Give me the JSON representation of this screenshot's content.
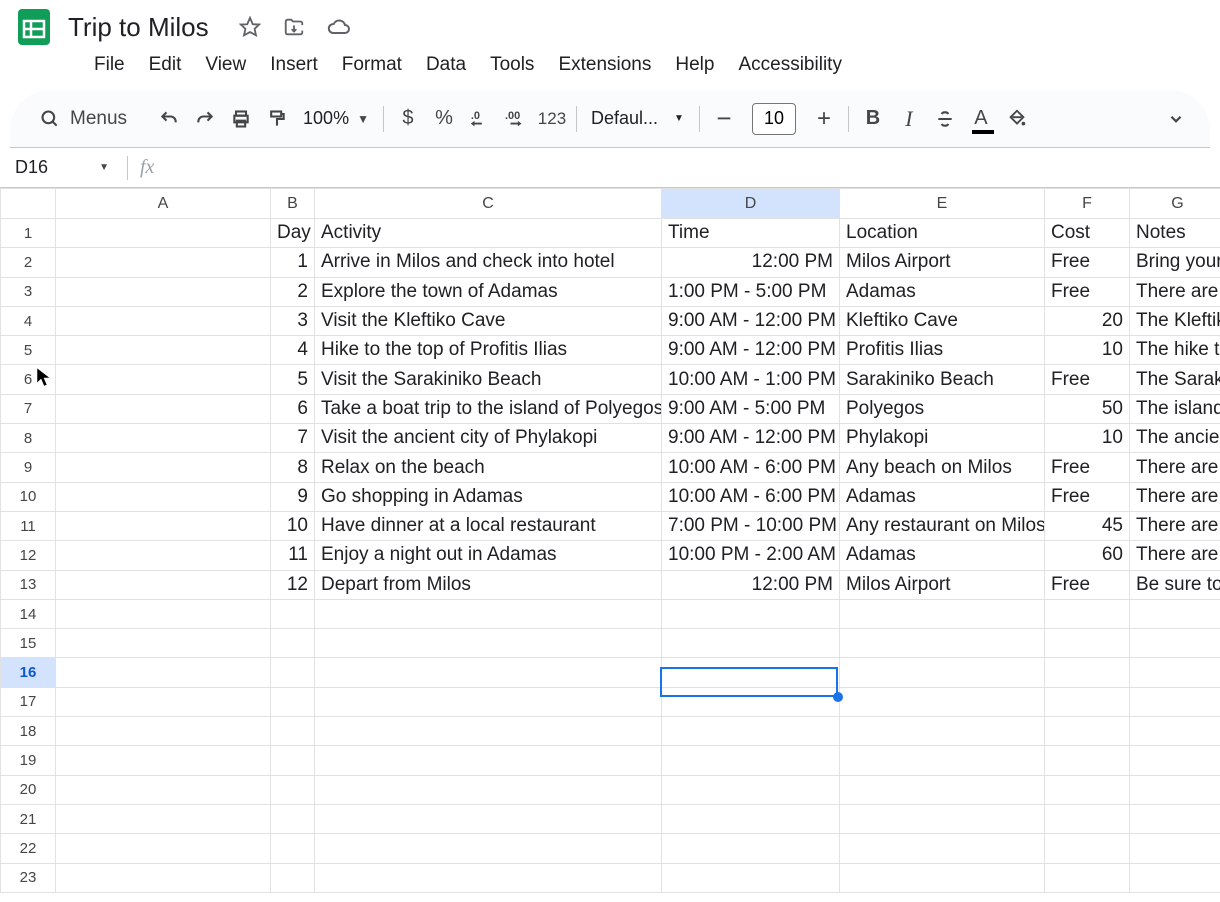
{
  "doc": {
    "title": "Trip to Milos"
  },
  "menubar": {
    "file": "File",
    "edit": "Edit",
    "view": "View",
    "insert": "Insert",
    "format": "Format",
    "data": "Data",
    "tools": "Tools",
    "extensions": "Extensions",
    "help": "Help",
    "accessibility": "Accessibility"
  },
  "toolbar": {
    "menus_label": "Menus",
    "zoom": "100%",
    "numfmt_123": "123",
    "font_name": "Defaul...",
    "font_size": "10"
  },
  "namebox": {
    "cell_ref": "D16",
    "formula": ""
  },
  "columns": [
    "A",
    "B",
    "C",
    "D",
    "E",
    "F",
    "G"
  ],
  "active_col": "D",
  "active_row": 16,
  "selected_cell": "D16",
  "row_count": 23,
  "headers": {
    "B": "Day",
    "C": "Activity",
    "D": "Time",
    "E": "Location",
    "F": "Cost",
    "G": "Notes"
  },
  "rows": [
    {
      "day": "1",
      "activity": "Arrive in Milos and check into hotel",
      "time": "12:00 PM",
      "location": "Milos Airport",
      "cost": "Free",
      "notes": "Bring your"
    },
    {
      "day": "2",
      "activity": "Explore the town of Adamas",
      "time": "1:00 PM - 5:00 PM",
      "location": "Adamas",
      "cost": "Free",
      "notes": "There are"
    },
    {
      "day": "3",
      "activity": "Visit the Kleftiko Cave",
      "time": "9:00 AM - 12:00 PM",
      "location": "Kleftiko Cave",
      "cost": "20",
      "notes": "The Kleftik"
    },
    {
      "day": "4",
      "activity": "Hike to the top of Profitis Ilias",
      "time": "9:00 AM - 12:00 PM",
      "location": "Profitis Ilias",
      "cost": "10",
      "notes": "The hike to"
    },
    {
      "day": "5",
      "activity": "Visit the Sarakiniko Beach",
      "time": "10:00 AM - 1:00 PM",
      "location": "Sarakiniko Beach",
      "cost": "Free",
      "notes": "The Sarak"
    },
    {
      "day": "6",
      "activity": "Take a boat trip to the island of Polyegos",
      "time": "9:00 AM - 5:00 PM",
      "location": "Polyegos",
      "cost": "50",
      "notes": "The island"
    },
    {
      "day": "7",
      "activity": "Visit the ancient city of Phylakopi",
      "time": "9:00 AM - 12:00 PM",
      "location": "Phylakopi",
      "cost": "10",
      "notes": "The ancien"
    },
    {
      "day": "8",
      "activity": "Relax on the beach",
      "time": "10:00 AM - 6:00 PM",
      "location": "Any beach on Milos",
      "cost": "Free",
      "notes": "There are"
    },
    {
      "day": "9",
      "activity": "Go shopping in Adamas",
      "time": "10:00 AM - 6:00 PM",
      "location": "Adamas",
      "cost": "Free",
      "notes": "There are"
    },
    {
      "day": "10",
      "activity": "Have dinner at a local restaurant",
      "time": "7:00 PM - 10:00 PM",
      "location": "Any restaurant on Milos",
      "cost": "45",
      "notes": "There are"
    },
    {
      "day": "11",
      "activity": "Enjoy a night out in Adamas",
      "time": "10:00 PM - 2:00 AM",
      "location": "Adamas",
      "cost": "60",
      "notes": "There are"
    },
    {
      "day": "12",
      "activity": "Depart from Milos",
      "time": "12:00 PM",
      "location": "Milos Airport",
      "cost": "Free",
      "notes": "Be sure to"
    }
  ]
}
